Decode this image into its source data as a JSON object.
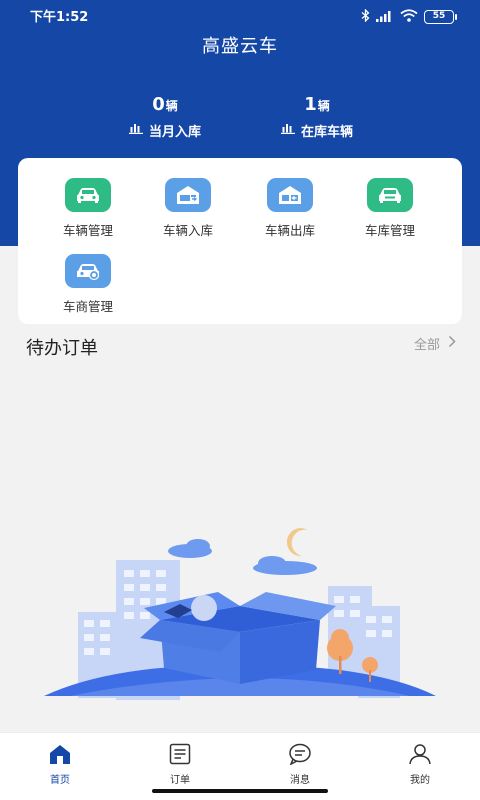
{
  "status": {
    "time": "下午1:52",
    "battery": "55"
  },
  "app_title": "高盛云车",
  "stats": [
    {
      "value": "0",
      "unit": "辆",
      "label": "当月入库"
    },
    {
      "value": "1",
      "unit": "辆",
      "label": "在库车辆"
    }
  ],
  "menu": [
    {
      "label": "车辆管理",
      "icon": "car-manage-icon"
    },
    {
      "label": "车辆入库",
      "icon": "warehouse-in-icon"
    },
    {
      "label": "车辆出库",
      "icon": "warehouse-out-icon"
    },
    {
      "label": "车库管理",
      "icon": "garage-manage-icon"
    },
    {
      "label": "车商管理",
      "icon": "dealer-manage-icon"
    }
  ],
  "section": {
    "title": "待办订单",
    "all_label": "全部"
  },
  "tabs": [
    {
      "label": "首页",
      "icon": "home-icon",
      "active": true
    },
    {
      "label": "订单",
      "icon": "order-icon",
      "active": false
    },
    {
      "label": "消息",
      "icon": "message-icon",
      "active": false
    },
    {
      "label": "我的",
      "icon": "user-icon",
      "active": false
    }
  ],
  "colors": {
    "primary": "#1447a6",
    "green": "#2fbb85",
    "blue": "#5b9fe6"
  }
}
